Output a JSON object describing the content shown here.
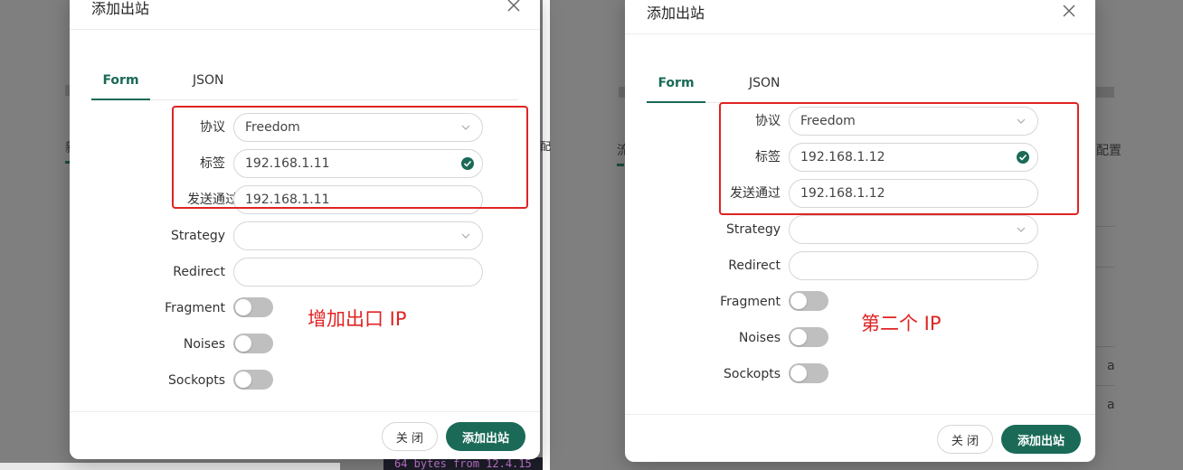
{
  "background": {
    "left_fragments": [
      "新",
      "配"
    ],
    "right_fragments": [
      "流",
      "配置",
      "a",
      "a"
    ],
    "terminal_text": "64 bytes from 12.4.15"
  },
  "dialogs": [
    {
      "title": "添加出站",
      "tabs": {
        "form": "Form",
        "json": "JSON"
      },
      "fields": {
        "protocol": {
          "label": "协议",
          "value": "Freedom"
        },
        "tag": {
          "label": "标签",
          "value": "192.168.1.11"
        },
        "send_through": {
          "label": "发送通过",
          "value": "192.168.1.11"
        },
        "strategy": {
          "label": "Strategy",
          "value": ""
        },
        "redirect": {
          "label": "Redirect",
          "value": ""
        },
        "fragment": {
          "label": "Fragment",
          "on": false
        },
        "noises": {
          "label": "Noises",
          "on": false
        },
        "sockopts": {
          "label": "Sockopts",
          "on": false
        }
      },
      "annotation": "增加出口 IP",
      "buttons": {
        "cancel": "关 闭",
        "submit": "添加出站"
      }
    },
    {
      "title": "添加出站",
      "tabs": {
        "form": "Form",
        "json": "JSON"
      },
      "fields": {
        "protocol": {
          "label": "协议",
          "value": "Freedom"
        },
        "tag": {
          "label": "标签",
          "value": "192.168.1.12"
        },
        "send_through": {
          "label": "发送通过",
          "value": "192.168.1.12"
        },
        "strategy": {
          "label": "Strategy",
          "value": ""
        },
        "redirect": {
          "label": "Redirect",
          "value": ""
        },
        "fragment": {
          "label": "Fragment",
          "on": false
        },
        "noises": {
          "label": "Noises",
          "on": false
        },
        "sockopts": {
          "label": "Sockopts",
          "on": false
        }
      },
      "annotation": "第二个 IP",
      "buttons": {
        "cancel": "关 闭",
        "submit": "添加出站"
      }
    }
  ],
  "colors": {
    "accent": "#1a6a57",
    "annotation_red": "#e02323",
    "overlay": "#7f7f7f"
  }
}
